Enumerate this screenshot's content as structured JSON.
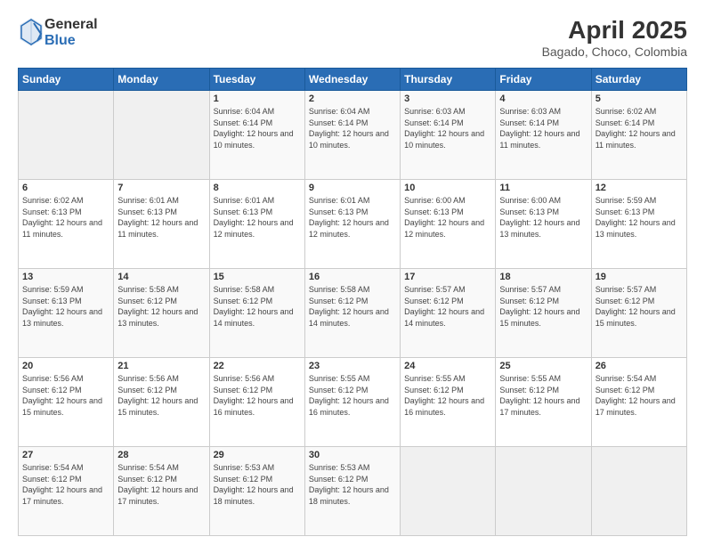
{
  "header": {
    "logo": {
      "general": "General",
      "blue": "Blue"
    },
    "title": "April 2025",
    "subtitle": "Bagado, Choco, Colombia"
  },
  "calendar": {
    "days_of_week": [
      "Sunday",
      "Monday",
      "Tuesday",
      "Wednesday",
      "Thursday",
      "Friday",
      "Saturday"
    ],
    "weeks": [
      [
        {
          "day": "",
          "info": ""
        },
        {
          "day": "",
          "info": ""
        },
        {
          "day": "1",
          "info": "Sunrise: 6:04 AM\nSunset: 6:14 PM\nDaylight: 12 hours and 10 minutes."
        },
        {
          "day": "2",
          "info": "Sunrise: 6:04 AM\nSunset: 6:14 PM\nDaylight: 12 hours and 10 minutes."
        },
        {
          "day": "3",
          "info": "Sunrise: 6:03 AM\nSunset: 6:14 PM\nDaylight: 12 hours and 10 minutes."
        },
        {
          "day": "4",
          "info": "Sunrise: 6:03 AM\nSunset: 6:14 PM\nDaylight: 12 hours and 11 minutes."
        },
        {
          "day": "5",
          "info": "Sunrise: 6:02 AM\nSunset: 6:14 PM\nDaylight: 12 hours and 11 minutes."
        }
      ],
      [
        {
          "day": "6",
          "info": "Sunrise: 6:02 AM\nSunset: 6:13 PM\nDaylight: 12 hours and 11 minutes."
        },
        {
          "day": "7",
          "info": "Sunrise: 6:01 AM\nSunset: 6:13 PM\nDaylight: 12 hours and 11 minutes."
        },
        {
          "day": "8",
          "info": "Sunrise: 6:01 AM\nSunset: 6:13 PM\nDaylight: 12 hours and 12 minutes."
        },
        {
          "day": "9",
          "info": "Sunrise: 6:01 AM\nSunset: 6:13 PM\nDaylight: 12 hours and 12 minutes."
        },
        {
          "day": "10",
          "info": "Sunrise: 6:00 AM\nSunset: 6:13 PM\nDaylight: 12 hours and 12 minutes."
        },
        {
          "day": "11",
          "info": "Sunrise: 6:00 AM\nSunset: 6:13 PM\nDaylight: 12 hours and 13 minutes."
        },
        {
          "day": "12",
          "info": "Sunrise: 5:59 AM\nSunset: 6:13 PM\nDaylight: 12 hours and 13 minutes."
        }
      ],
      [
        {
          "day": "13",
          "info": "Sunrise: 5:59 AM\nSunset: 6:13 PM\nDaylight: 12 hours and 13 minutes."
        },
        {
          "day": "14",
          "info": "Sunrise: 5:58 AM\nSunset: 6:12 PM\nDaylight: 12 hours and 13 minutes."
        },
        {
          "day": "15",
          "info": "Sunrise: 5:58 AM\nSunset: 6:12 PM\nDaylight: 12 hours and 14 minutes."
        },
        {
          "day": "16",
          "info": "Sunrise: 5:58 AM\nSunset: 6:12 PM\nDaylight: 12 hours and 14 minutes."
        },
        {
          "day": "17",
          "info": "Sunrise: 5:57 AM\nSunset: 6:12 PM\nDaylight: 12 hours and 14 minutes."
        },
        {
          "day": "18",
          "info": "Sunrise: 5:57 AM\nSunset: 6:12 PM\nDaylight: 12 hours and 15 minutes."
        },
        {
          "day": "19",
          "info": "Sunrise: 5:57 AM\nSunset: 6:12 PM\nDaylight: 12 hours and 15 minutes."
        }
      ],
      [
        {
          "day": "20",
          "info": "Sunrise: 5:56 AM\nSunset: 6:12 PM\nDaylight: 12 hours and 15 minutes."
        },
        {
          "day": "21",
          "info": "Sunrise: 5:56 AM\nSunset: 6:12 PM\nDaylight: 12 hours and 15 minutes."
        },
        {
          "day": "22",
          "info": "Sunrise: 5:56 AM\nSunset: 6:12 PM\nDaylight: 12 hours and 16 minutes."
        },
        {
          "day": "23",
          "info": "Sunrise: 5:55 AM\nSunset: 6:12 PM\nDaylight: 12 hours and 16 minutes."
        },
        {
          "day": "24",
          "info": "Sunrise: 5:55 AM\nSunset: 6:12 PM\nDaylight: 12 hours and 16 minutes."
        },
        {
          "day": "25",
          "info": "Sunrise: 5:55 AM\nSunset: 6:12 PM\nDaylight: 12 hours and 17 minutes."
        },
        {
          "day": "26",
          "info": "Sunrise: 5:54 AM\nSunset: 6:12 PM\nDaylight: 12 hours and 17 minutes."
        }
      ],
      [
        {
          "day": "27",
          "info": "Sunrise: 5:54 AM\nSunset: 6:12 PM\nDaylight: 12 hours and 17 minutes."
        },
        {
          "day": "28",
          "info": "Sunrise: 5:54 AM\nSunset: 6:12 PM\nDaylight: 12 hours and 17 minutes."
        },
        {
          "day": "29",
          "info": "Sunrise: 5:53 AM\nSunset: 6:12 PM\nDaylight: 12 hours and 18 minutes."
        },
        {
          "day": "30",
          "info": "Sunrise: 5:53 AM\nSunset: 6:12 PM\nDaylight: 12 hours and 18 minutes."
        },
        {
          "day": "",
          "info": ""
        },
        {
          "day": "",
          "info": ""
        },
        {
          "day": "",
          "info": ""
        }
      ]
    ]
  }
}
